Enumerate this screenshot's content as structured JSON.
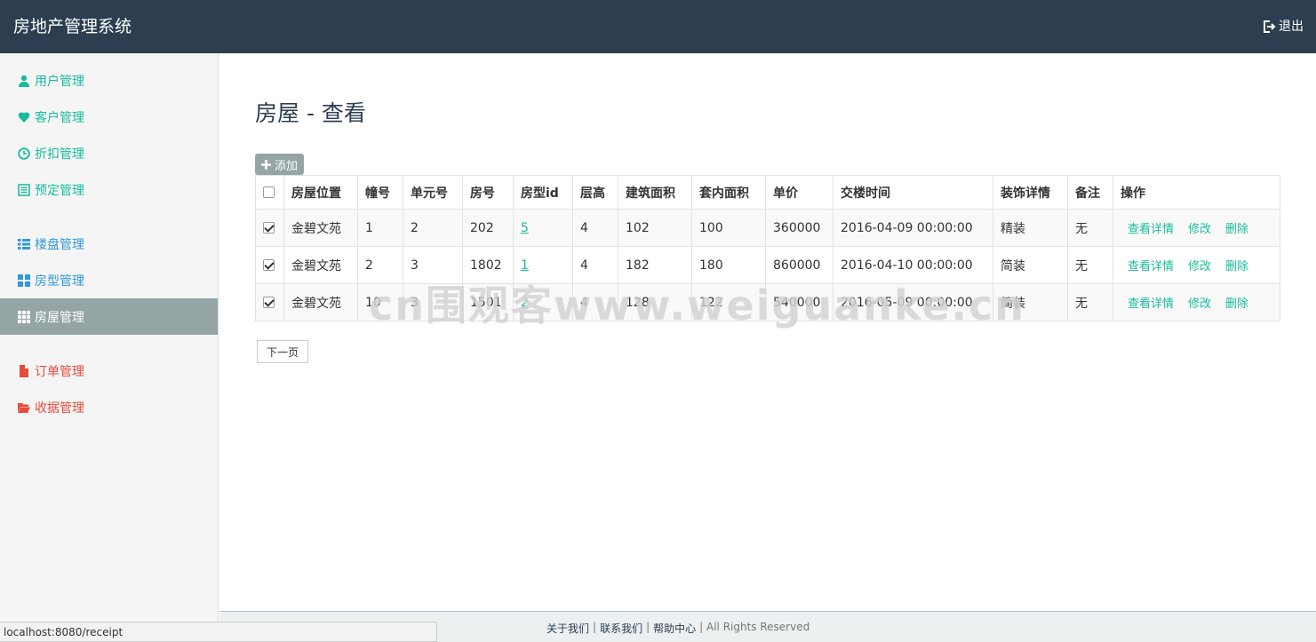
{
  "app": {
    "title": "房地产管理系统",
    "logout_label": "退出"
  },
  "sidebar": {
    "items": [
      {
        "label": "用户管理"
      },
      {
        "label": "客户管理"
      },
      {
        "label": "折扣管理"
      },
      {
        "label": "预定管理"
      },
      {
        "label": "楼盘管理"
      },
      {
        "label": "房型管理"
      },
      {
        "label": "房屋管理",
        "active": true
      },
      {
        "label": "订单管理"
      },
      {
        "label": "收据管理"
      }
    ]
  },
  "main": {
    "title": "房屋 - 查看",
    "add_label": "添加",
    "next_label": "下一页",
    "columns": [
      "房屋位置",
      "幢号",
      "单元号",
      "房号",
      "房型id",
      "层高",
      "建筑面积",
      "套内面积",
      "单价",
      "交楼时间",
      "装饰详情",
      "备注",
      "操作"
    ],
    "rows": [
      {
        "location": "金碧文苑",
        "building": "1",
        "unit": "2",
        "room": "202",
        "type_id": "5",
        "floor": "4",
        "area": "102",
        "inner_area": "100",
        "price": "360000",
        "handover": "2016-04-09 00:00:00",
        "decoration": "精装",
        "remark": "无"
      },
      {
        "location": "金碧文苑",
        "building": "2",
        "unit": "3",
        "room": "1802",
        "type_id": "1",
        "floor": "4",
        "area": "182",
        "inner_area": "180",
        "price": "860000",
        "handover": "2016-04-10 00:00:00",
        "decoration": "简装",
        "remark": "无"
      },
      {
        "location": "金碧文苑",
        "building": "10",
        "unit": "3",
        "room": "1501",
        "type_id": "2",
        "floor": "4",
        "area": "128",
        "inner_area": "122",
        "price": "540000",
        "handover": "2016-05-09 00:00:00",
        "decoration": "简装",
        "remark": "无"
      }
    ],
    "actions": {
      "view": "查看详情",
      "edit": "修改",
      "delete": "删除"
    }
  },
  "watermark": "cn围观客www.weiguanke.cn",
  "footer": {
    "about": "关于我们",
    "contact": "联系我们",
    "help": "帮助中心",
    "rights": "| All Rights Reserved",
    "sep": "|"
  },
  "status_bar": "localhost:8080/receipt"
}
